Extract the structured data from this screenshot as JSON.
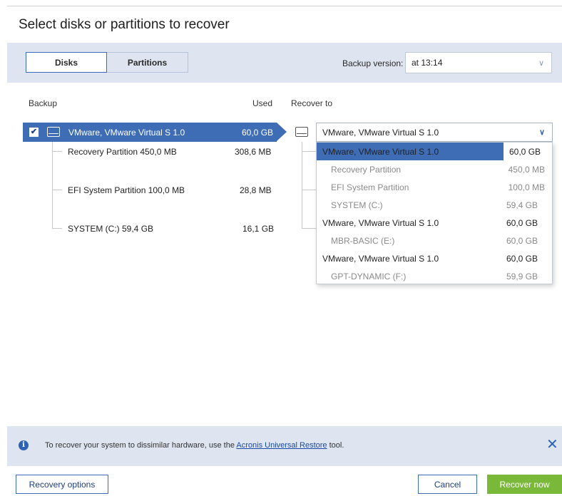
{
  "title": "Select disks or partitions to recover",
  "tabs": {
    "disks": "Disks",
    "partitions": "Partitions"
  },
  "backup_version": {
    "label": "Backup version:",
    "value": "at 13:14"
  },
  "columns": {
    "backup": "Backup",
    "used": "Used",
    "recover_to": "Recover to"
  },
  "backup_disk": {
    "name": "VMware, VMware Virtual S 1.0",
    "used": "60,0 GB",
    "checked": true
  },
  "partitions": [
    {
      "name": "Recovery Partition 450,0 MB",
      "used": "308,6 MB"
    },
    {
      "name": "EFI System Partition 100,0 MB",
      "used": "28,8 MB"
    },
    {
      "name": "SYSTEM (C:) 59,4 GB",
      "used": "16,1 GB"
    }
  ],
  "recover_to_selected": "VMware, VMware Virtual S 1.0",
  "dropdown_items": [
    {
      "name": "VMware, VMware Virtual S 1.0",
      "size": "60,0 GB",
      "kind": "disk",
      "selected": true
    },
    {
      "name": "Recovery Partition",
      "size": "450,0 MB",
      "kind": "part"
    },
    {
      "name": "EFI System Partition",
      "size": "100,0 MB",
      "kind": "part"
    },
    {
      "name": "SYSTEM (C:)",
      "size": "59,4 GB",
      "kind": "part"
    },
    {
      "name": "VMware, VMware Virtual S 1.0",
      "size": "60,0 GB",
      "kind": "disk"
    },
    {
      "name": "MBR-BASIC (E:)",
      "size": "60,0 GB",
      "kind": "part"
    },
    {
      "name": "VMware, VMware Virtual S 1.0",
      "size": "60,0 GB",
      "kind": "disk"
    },
    {
      "name": "GPT-DYNAMIC (F:)",
      "size": "59,9 GB",
      "kind": "part"
    }
  ],
  "info": {
    "before": "To recover your system to dissimilar hardware, use the ",
    "link": "Acronis Universal Restore",
    "after": " tool."
  },
  "buttons": {
    "recovery_options": "Recovery options",
    "cancel": "Cancel",
    "recover_now": "Recover now"
  },
  "colors": {
    "accent": "#3f6db5",
    "panel": "#dee5f0",
    "primary_button": "#7ab83a"
  }
}
